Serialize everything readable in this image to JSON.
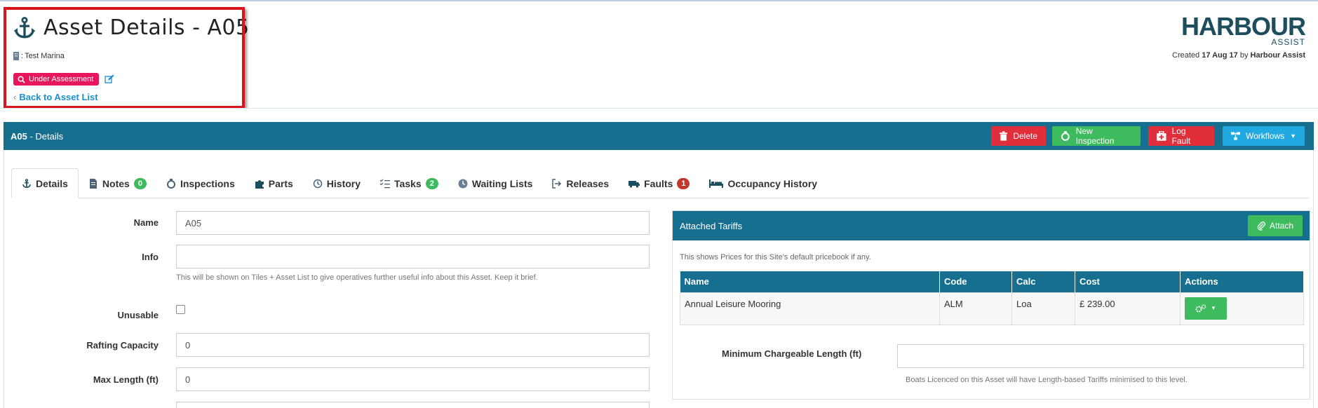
{
  "header": {
    "title": "Asset Details - A05",
    "marina_prefix": ": ",
    "marina": "Test Marina",
    "status": "Under Assessment",
    "back_link": "Back to Asset List",
    "logo_main": "HARBOUR",
    "logo_sub": "ASSIST",
    "created_prefix": "Created",
    "created_date": "17 Aug 17",
    "created_by_prefix": "by",
    "created_by": "Harbour Assist"
  },
  "panel": {
    "title_bold": "A05",
    "title_rest": " - Details",
    "buttons": {
      "delete": "Delete",
      "new_inspection": "New Inspection",
      "log_fault": "Log Fault",
      "workflows": "Workflows"
    }
  },
  "tabs": [
    {
      "label": "Details",
      "icon": "anchor-icon"
    },
    {
      "label": "Notes",
      "icon": "file-icon",
      "count": "0"
    },
    {
      "label": "Inspections",
      "icon": "inspection-icon"
    },
    {
      "label": "Parts",
      "icon": "puzzle-icon"
    },
    {
      "label": "History",
      "icon": "history-icon"
    },
    {
      "label": "Tasks",
      "icon": "tasks-icon",
      "count": "2"
    },
    {
      "label": "Waiting Lists",
      "icon": "clock-icon"
    },
    {
      "label": "Releases",
      "icon": "release-icon"
    },
    {
      "label": "Faults",
      "icon": "fault-icon",
      "count": "1"
    },
    {
      "label": "Occupancy History",
      "icon": "bed-icon"
    }
  ],
  "form": {
    "name_label": "Name",
    "name_value": "A05",
    "info_label": "Info",
    "info_value": "",
    "info_help": "This will be shown on Tiles + Asset List to give operatives further useful info about this Asset. Keep it brief.",
    "unusable_label": "Unusable",
    "unusable_checked": false,
    "rafting_label": "Rafting Capacity",
    "rafting_value": "0",
    "maxlen_label": "Max Length (ft)",
    "maxlen_value": "0"
  },
  "tariffs": {
    "title": "Attached Tariffs",
    "attach_label": "Attach",
    "note": "This shows Prices for this Site's default pricebook if any.",
    "columns": [
      "Name",
      "Code",
      "Calc",
      "Cost",
      "Actions"
    ],
    "rows": [
      {
        "name": "Annual Leisure Mooring",
        "code": "ALM",
        "calc": "Loa",
        "cost": "£ 239.00"
      }
    ],
    "min_length_label": "Minimum Chargeable Length (ft)",
    "min_length_value": "",
    "min_length_help": "Boats Licenced on this Asset will have Length-based Tariffs minimised to this level."
  },
  "colors": {
    "primary": "#176f8f",
    "danger": "#e02f3a",
    "success": "#3dbb5e",
    "info": "#23a9e1",
    "status_pink": "#e8175d",
    "highlight_red": "#d9141b"
  }
}
